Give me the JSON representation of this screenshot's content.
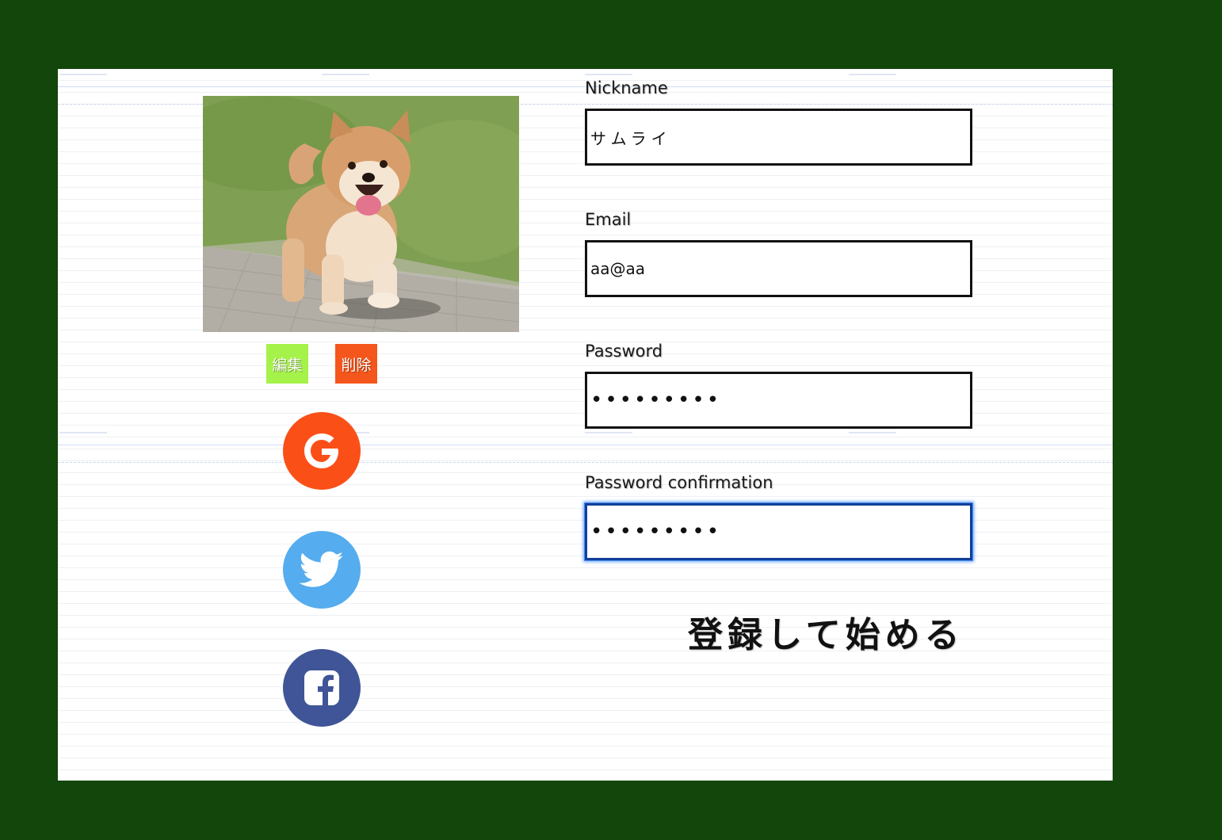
{
  "profile": {
    "photo_alt": "Shiba Inu puppy",
    "edit_label": "編集",
    "delete_label": "削除"
  },
  "social": {
    "google_icon": "google-icon",
    "twitter_icon": "twitter-icon",
    "facebook_icon": "facebook-icon"
  },
  "form": {
    "nickname_label": "Nickname",
    "nickname_value": "サムライ",
    "email_label": "Email",
    "email_value": "aa@aa",
    "password_label": "Password",
    "password_value": "•••••••••",
    "password_confirmation_label": "Password confirmation",
    "password_confirmation_value": "•••••••••",
    "submit_label": "登録して始める"
  },
  "colors": {
    "page_background": "#12460a",
    "edit_button": "#a5f24a",
    "delete_button": "#f5561c",
    "google": "#fa5018",
    "twitter": "#55acee",
    "facebook": "#3f5597",
    "focus_border": "#0f3f9a"
  }
}
